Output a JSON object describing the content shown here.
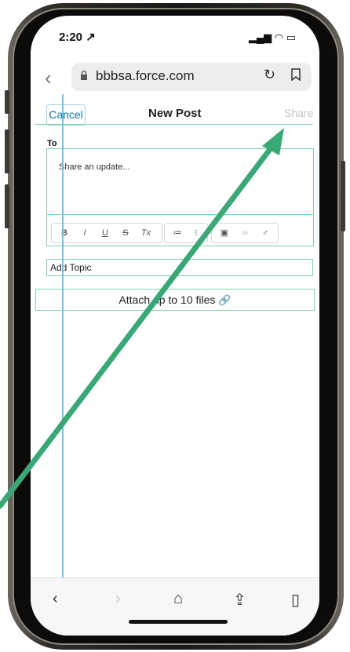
{
  "status_bar": {
    "time": "2:20 ↗",
    "icons": "▂▄▆ ◠ ▭"
  },
  "browser": {
    "back_icon": "chevron-left-icon",
    "url": "bbbsa.force.com",
    "reload_icon": "reload-icon",
    "bookmark_icon": "bookmark-icon"
  },
  "post_header": {
    "cancel_label": "Cancel",
    "title": "New Post",
    "share_label": "Share"
  },
  "form": {
    "to_label": "To",
    "editor_placeholder": "Share an update...",
    "toolbar": [
      "B",
      "I",
      "U",
      "S",
      "Tx",
      "≔",
      "⁝",
      "▣",
      "∞",
      "♂"
    ],
    "topic_placeholder": "Add Topic",
    "attach_label": "Attach up to 10 files",
    "attach_icon": "🔗"
  },
  "bottom_nav": {
    "back": "‹",
    "forward": "›",
    "home": "⌂",
    "share": "⇪",
    "tabs": "▯"
  },
  "colors": {
    "accent_border": "#7bd8a8",
    "arrow": "#3aa777",
    "link": "#1a73b5"
  }
}
